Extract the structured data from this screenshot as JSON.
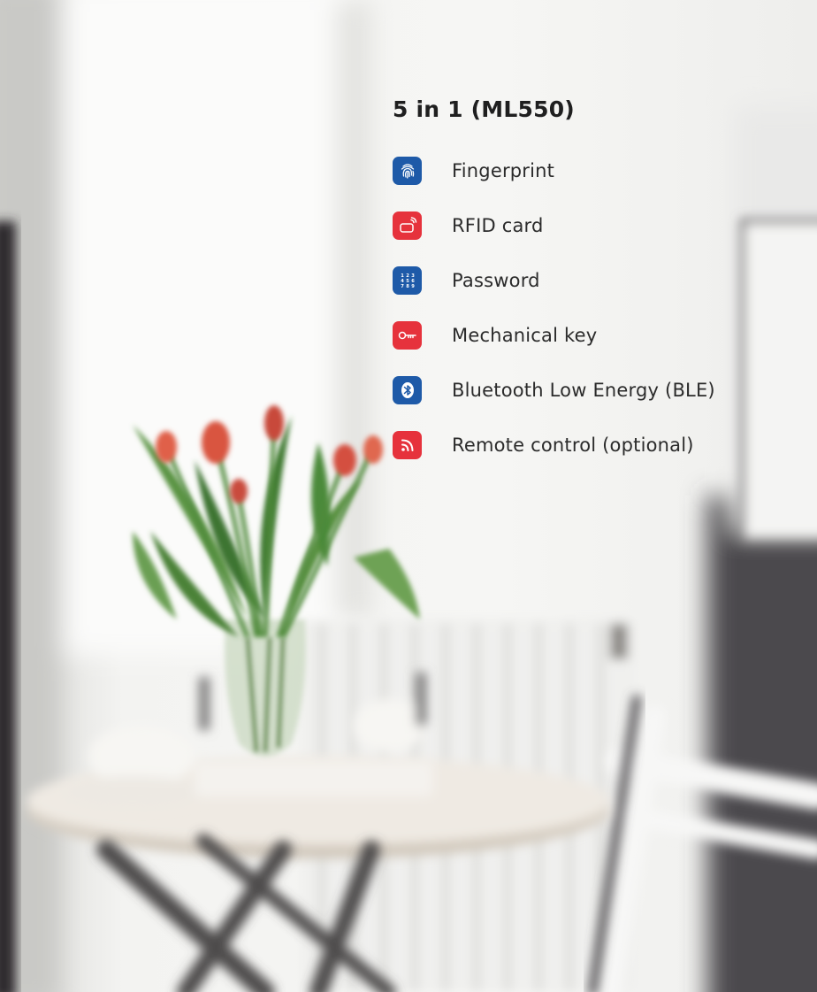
{
  "heading": "5 in 1 (ML550)",
  "features": [
    {
      "label": "Fingerprint",
      "icon": "fingerprint-icon",
      "color": "#1e5aa8"
    },
    {
      "label": "RFID card",
      "icon": "rfid-card-icon",
      "color": "#e6323c"
    },
    {
      "label": "Password",
      "icon": "keypad-icon",
      "color": "#1e5aa8",
      "keypad_digits": [
        "1",
        "2",
        "3",
        "4",
        "5",
        "6",
        "7",
        "8",
        "9"
      ]
    },
    {
      "label": "Mechanical key",
      "icon": "key-icon",
      "color": "#e6323c"
    },
    {
      "label": "Bluetooth Low Energy (BLE)",
      "icon": "bluetooth-icon",
      "color": "#1e5aa8"
    },
    {
      "label": "Remote control (optional)",
      "icon": "remote-control-icon",
      "color": "#e6323c"
    }
  ]
}
